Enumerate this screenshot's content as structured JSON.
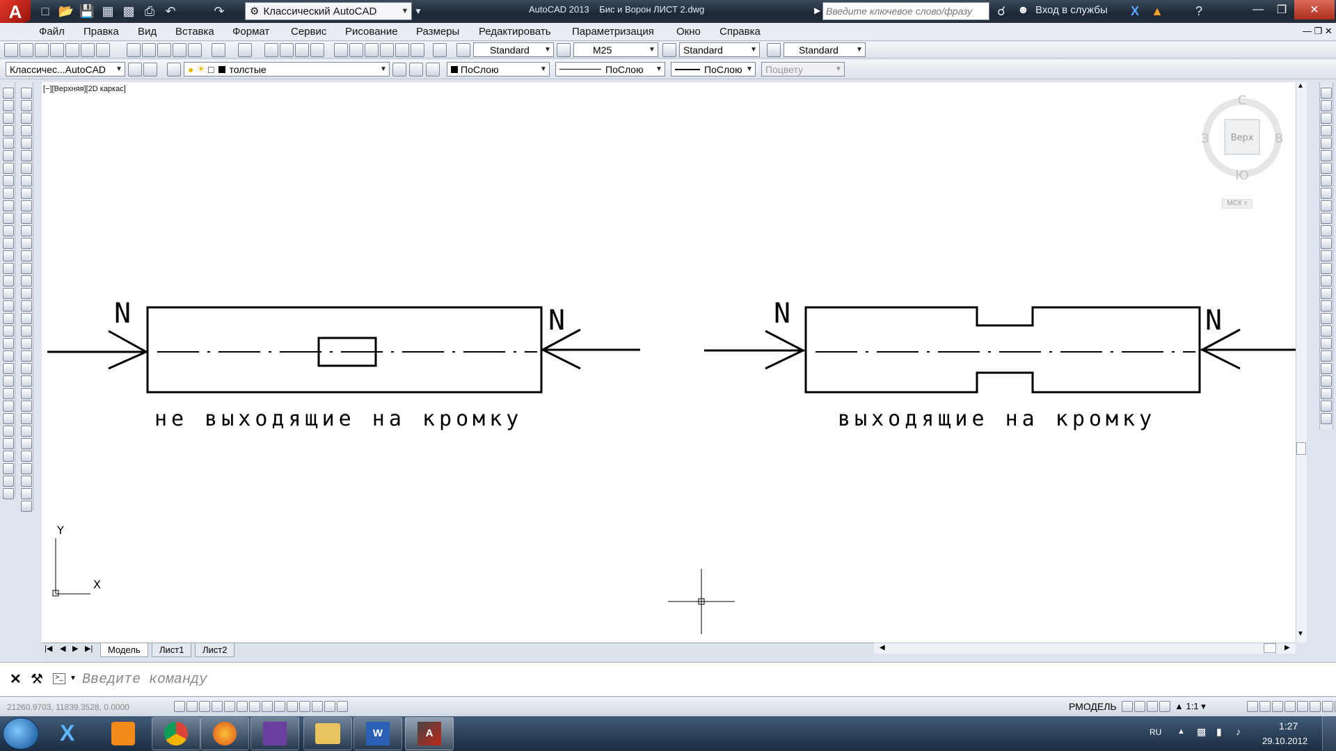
{
  "titlebar": {
    "workspace": "Классический AutoCAD",
    "app": "AutoCAD 2013",
    "file": "Бис и Ворон ЛИСТ 2.dwg",
    "search_placeholder": "Введите ключевое слово/фразу",
    "signin": "Вход в службы"
  },
  "menu": [
    "Файл",
    "Правка",
    "Вид",
    "Вставка",
    "Формат",
    "Сервис",
    "Рисование",
    "Размеры",
    "Редактировать",
    "Параметризация",
    "Окно",
    "Справка"
  ],
  "styles_toolbar": {
    "text_style": "Standard",
    "dim_style": "M25",
    "table_style": "Standard",
    "mleader_style": "Standard"
  },
  "layers_toolbar": {
    "workspace_short": "Классичес...AutoCAD",
    "layer": "толстые",
    "color": "ПоСлою",
    "linetype": "ПоСлою",
    "lineweight": "ПоСлою",
    "plotstyle": "Поцвету"
  },
  "viewport": {
    "label": "[−][Верхняя][2D каркас]"
  },
  "viewcube": {
    "north": "С",
    "south": "Ю",
    "west": "З",
    "east": "В",
    "face": "Верх",
    "ucs": "МСК"
  },
  "drawing": {
    "left_caption": "не выходящие на кромку",
    "right_caption": "выходящие на кромку",
    "force_label": "N",
    "ucs_x": "X",
    "ucs_y": "Y"
  },
  "tabs": [
    "Модель",
    "Лист1",
    "Лист2"
  ],
  "command": {
    "placeholder": "Введите команду"
  },
  "status": {
    "coords": "21260.9703, 11839.3528, 0.0000",
    "space": "РМОДЕЛЬ",
    "scale": "1:1"
  },
  "taskbar": {
    "lang": "RU",
    "time": "1:27",
    "date": "29.10.2012"
  },
  "colors": {
    "accent": "#d43a2c",
    "titlebar": "#1d2735"
  }
}
